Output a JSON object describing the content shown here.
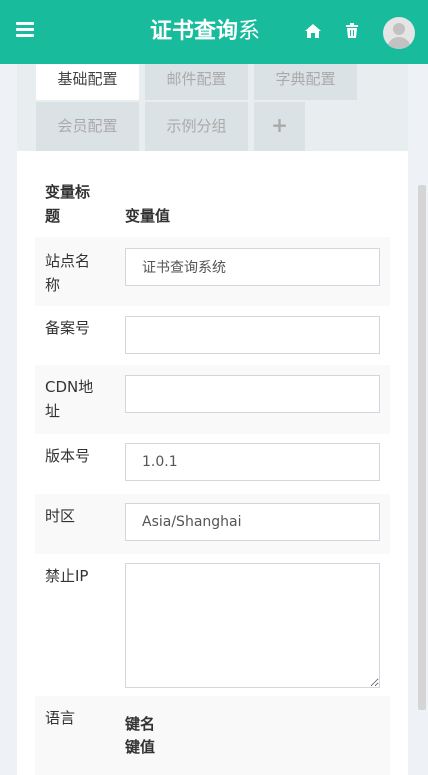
{
  "header": {
    "logo_bold": "证书查询",
    "logo_rest": "系",
    "menu_icon": "hamburger-icon",
    "home_icon": "home-icon",
    "trash_icon": "trash-icon",
    "avatar_icon": "user-avatar"
  },
  "tabs": [
    {
      "label": "基础配置",
      "active": true
    },
    {
      "label": "邮件配置",
      "active": false
    },
    {
      "label": "字典配置",
      "active": false
    },
    {
      "label": "会员配置",
      "active": false
    },
    {
      "label": "示例分组",
      "active": false
    },
    {
      "label": "+",
      "active": false
    }
  ],
  "table": {
    "header_title": "变量标题",
    "header_title_line1": "变量标",
    "header_title_line2": "题",
    "header_value": "变量值",
    "rows": [
      {
        "label_l1": "站点名",
        "label_l2": "称",
        "value": "证书查询系统"
      },
      {
        "label_l1": "备案号",
        "label_l2": "",
        "value": ""
      },
      {
        "label_l1": "CDN地",
        "label_l2": "址",
        "value": ""
      },
      {
        "label_l1": "版本号",
        "label_l2": "",
        "value": "1.0.1"
      },
      {
        "label_l1": "时区",
        "label_l2": "",
        "value": "Asia/Shanghai"
      },
      {
        "label_l1": "禁止IP",
        "label_l2": "",
        "value": ""
      },
      {
        "label_l1": "语言",
        "label_l2": "",
        "key_header": "键名",
        "value_header": "键值"
      }
    ]
  }
}
